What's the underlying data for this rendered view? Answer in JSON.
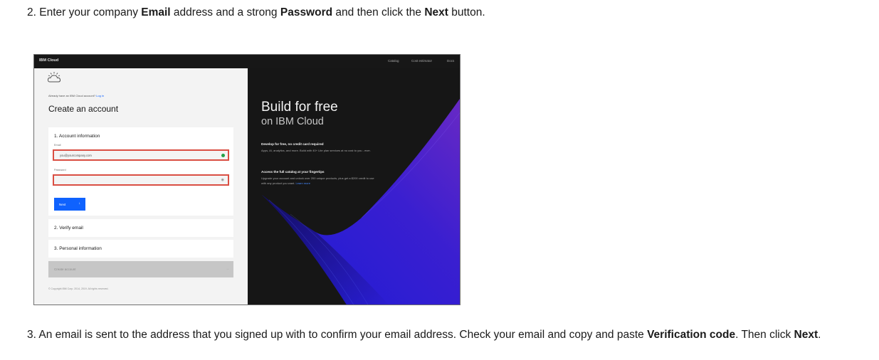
{
  "step2": {
    "prefix": "2. Enter your company ",
    "email_bold": "Email",
    "mid1": " address and a strong ",
    "password_bold": "Password",
    "mid2": " and then click the ",
    "next_bold": "Next",
    "suffix": " button."
  },
  "step3": {
    "prefix": "3. An email is sent to the address that you signed up with to confirm your email address. Check your email and copy and paste ",
    "code_bold": "Verification code",
    "mid": ". Then click ",
    "next_bold": "Next",
    "suffix": "."
  },
  "screenshot": {
    "brand": "IBM Cloud",
    "nav": {
      "catalog": "Catalog",
      "cost_estimator": "Cost estimator",
      "docs": "Docs"
    },
    "form": {
      "already_text": "Already have an IBM Cloud account?",
      "login_link": "Log in",
      "title": "Create an account",
      "section1_title": "1. Account information",
      "email_label": "Email",
      "email_value": "you@yourcompany.com",
      "password_label": "Password",
      "next_button": "Next",
      "section2_title": "2. Verify email",
      "section3_title": "3. Personal information",
      "create_button": "Create account",
      "copyright": "© Copyright IBM Corp. 2014, 2019. All rights reserved."
    },
    "hero": {
      "title": "Build for free",
      "subtitle": "on IBM Cloud",
      "promo1_head": "Develop for free, no credit card required",
      "promo1_text": "Apps, AI, analytics, and more. Build with 40+ Lite plan services at no cost to you - ever.",
      "promo2_head": "Access the full catalog at your fingertips",
      "promo2_text": "Upgrade your account and unlock over 200 unique products, plus get a $200 credit to use with any product you want.",
      "promo2_link": "Learn more"
    },
    "colors": {
      "accent": "#0f62fe",
      "highlight": "#da4f43",
      "success": "#24a148",
      "wave_start": "#1b1bd6",
      "wave_end": "#6929c4"
    },
    "icons": {
      "logo": "ibm-cloud-icon",
      "valid": "checkmark-dot-icon",
      "password_visibility": "eye-icon",
      "next": "arrow-right-icon"
    }
  }
}
